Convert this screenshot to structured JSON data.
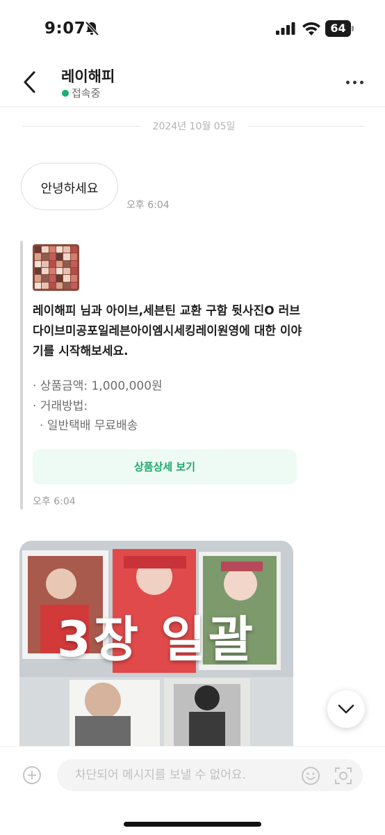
{
  "status_bar": {
    "time": "9:07",
    "battery": "64"
  },
  "header": {
    "title": "레이해피",
    "presence": "접속중"
  },
  "chat": {
    "date": "2024년 10월 05일",
    "greeting": {
      "text": "안녕하세요",
      "time": "오후 6:04"
    },
    "product_card": {
      "message": "레이해피 님과 아이브,세븐틴 교환 구함 뒷사진O 러브다이브미공포일레븐아이엠시세킹레이원영에 대한 이야기를 시작해보세요.",
      "price": "· 상품금액: 1,000,000원",
      "method_label": "· 거래방법:",
      "method_value": "· 일반택배 무료배송",
      "button_label": "상품상세 보기",
      "time": "오후 6:04"
    },
    "photo": {
      "caption": "3장 일괄"
    }
  },
  "composer": {
    "placeholder": "차단되어 메시지를 보낼 수 없어요."
  },
  "colors": {
    "accent_green": "#1ea56a",
    "presence_green": "#1cb172",
    "button_bg": "#eefaf4"
  }
}
